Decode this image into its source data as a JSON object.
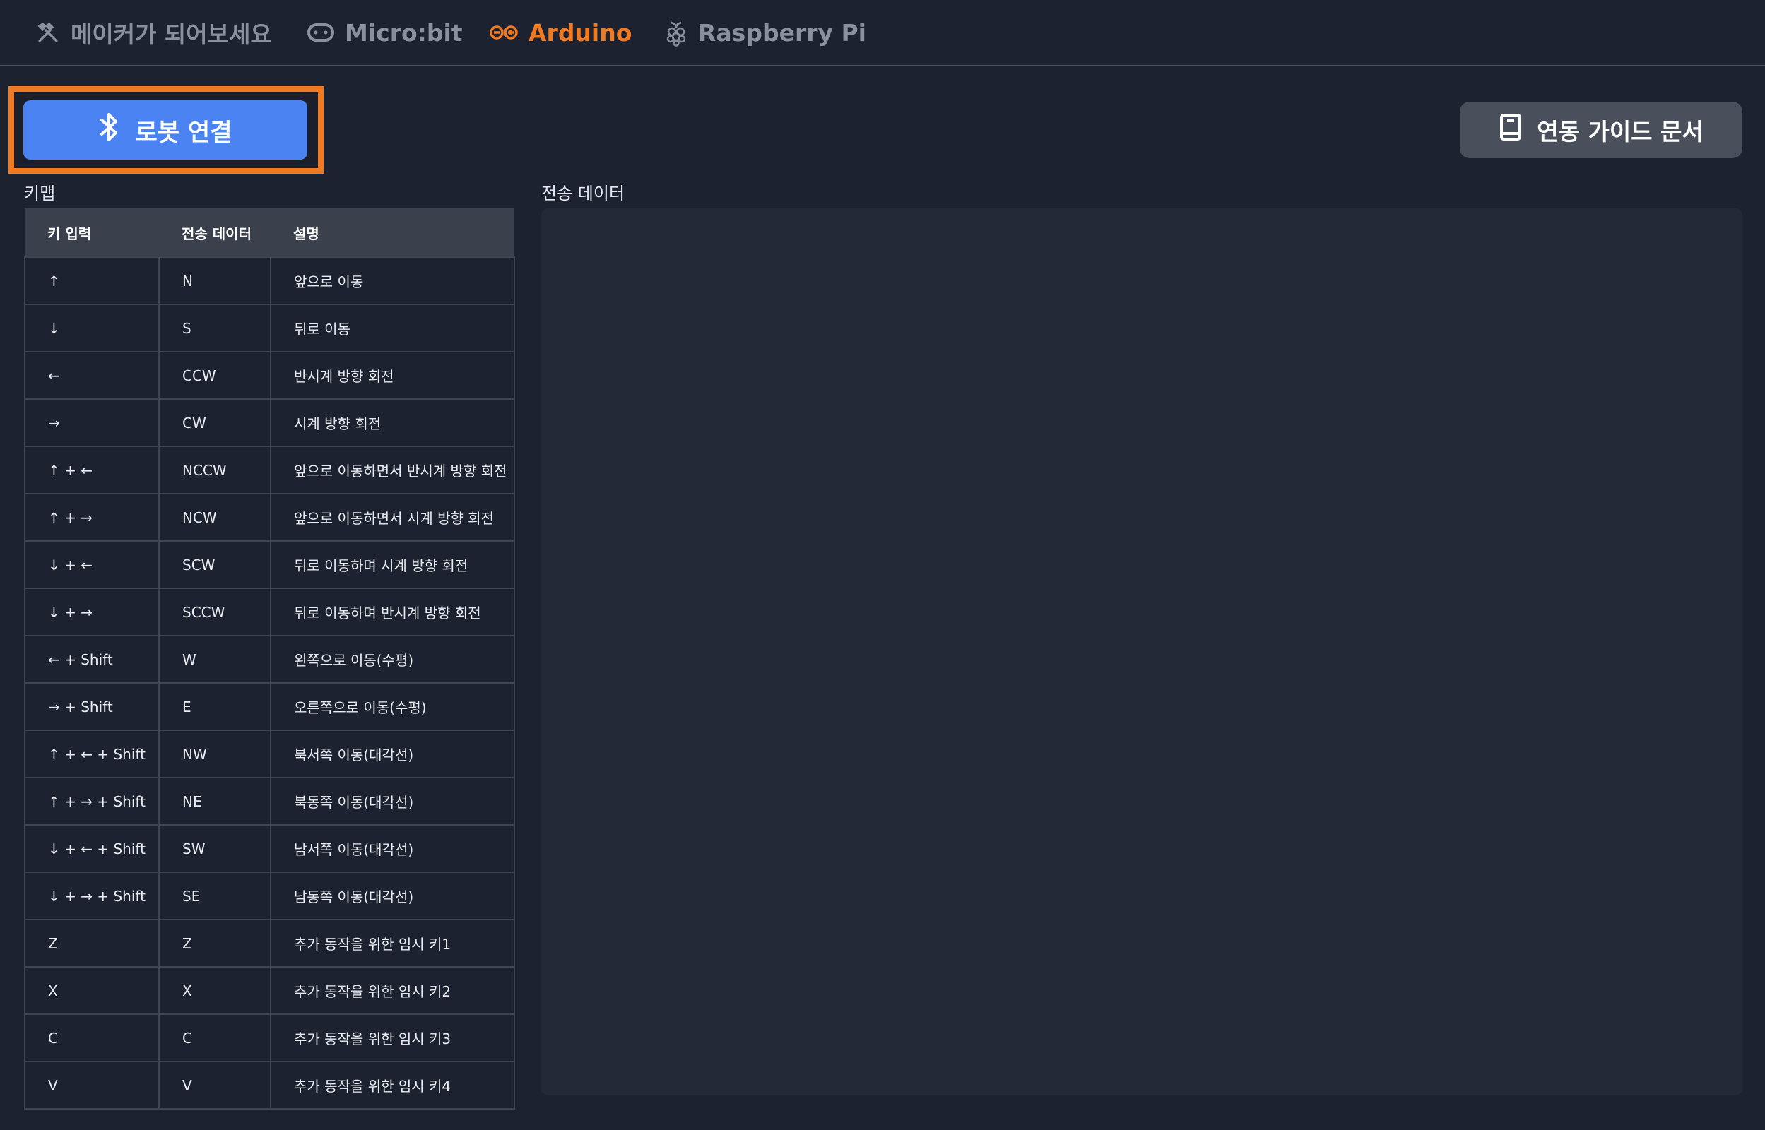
{
  "nav": {
    "items": [
      {
        "label": "메이커가 되어보세요",
        "icon": "tools-icon",
        "active": false
      },
      {
        "label": "Micro:bit",
        "icon": "microbit-icon",
        "active": false
      },
      {
        "label": "Arduino",
        "icon": "infinity-icon",
        "active": true
      },
      {
        "label": "Raspberry Pi",
        "icon": "raspberry-icon",
        "active": false
      }
    ],
    "active_color": "#ef7a22"
  },
  "toolbar": {
    "connect_label": "로봇 연결",
    "connect_icon": "bluetooth-icon",
    "guide_label": "연동 가이드 문서",
    "guide_icon": "book-icon"
  },
  "keymap": {
    "title": "키맵",
    "headers": [
      "키 입력",
      "전송 데이터",
      "설명"
    ],
    "rows": [
      [
        "↑",
        "N",
        "앞으로 이동"
      ],
      [
        "↓",
        "S",
        "뒤로 이동"
      ],
      [
        "←",
        "CCW",
        "반시계 방향 회전"
      ],
      [
        "→",
        "CW",
        "시계 방향 회전"
      ],
      [
        "↑ + ←",
        "NCCW",
        "앞으로 이동하면서 반시계 방향 회전"
      ],
      [
        "↑ + →",
        "NCW",
        "앞으로 이동하면서 시계 방향 회전"
      ],
      [
        "↓ + ←",
        "SCW",
        "뒤로 이동하며 시계 방향 회전"
      ],
      [
        "↓ + →",
        "SCCW",
        "뒤로 이동하며 반시계 방향 회전"
      ],
      [
        "← + Shift",
        "W",
        "왼쪽으로 이동(수평)"
      ],
      [
        "→ + Shift",
        "E",
        "오른쪽으로 이동(수평)"
      ],
      [
        "↑ + ← + Shift",
        "NW",
        "북서쪽 이동(대각선)"
      ],
      [
        "↑ + → + Shift",
        "NE",
        "북동쪽 이동(대각선)"
      ],
      [
        "↓ + ← + Shift",
        "SW",
        "남서쪽 이동(대각선)"
      ],
      [
        "↓ + → + Shift",
        "SE",
        "남동쪽 이동(대각선)"
      ],
      [
        "Z",
        "Z",
        "추가 동작을 위한 임시 키1"
      ],
      [
        "X",
        "X",
        "추가 동작을 위한 임시 키2"
      ],
      [
        "C",
        "C",
        "추가 동작을 위한 임시 키3"
      ],
      [
        "V",
        "V",
        "추가 동작을 위한 임시 키4"
      ]
    ]
  },
  "tx": {
    "title": "전송 데이터"
  }
}
